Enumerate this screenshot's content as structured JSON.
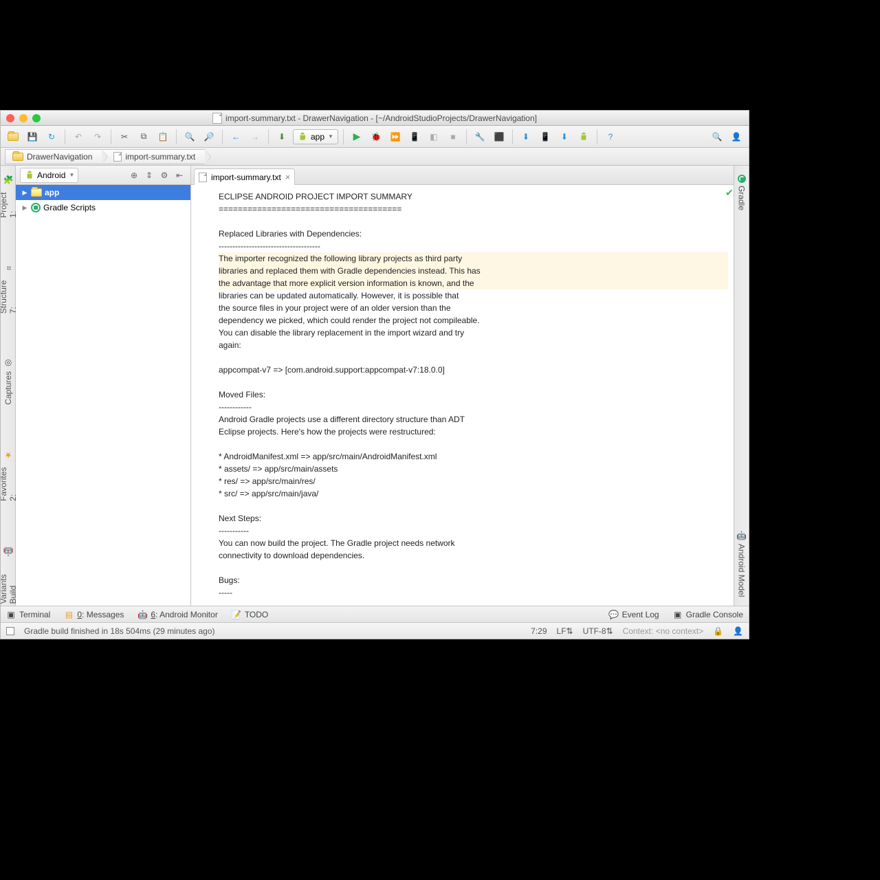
{
  "title": "import-summary.txt - DrawerNavigation - [~/AndroidStudioProjects/DrawerNavigation]",
  "breadcrumb": {
    "root": "DrawerNavigation",
    "file": "import-summary.txt"
  },
  "module_selector": "app",
  "sidebar": {
    "view": "Android",
    "items": [
      {
        "label": "app",
        "type": "folder",
        "selected": true,
        "expandable": true
      },
      {
        "label": "Gradle Scripts",
        "type": "gradle",
        "selected": false,
        "expandable": true
      }
    ]
  },
  "editor": {
    "tab": "import-summary.txt",
    "lines": [
      "ECLIPSE ANDROID PROJECT IMPORT SUMMARY",
      "======================================",
      "",
      "Replaced Libraries with Dependencies:",
      "-------------------------------------",
      "The importer recognized the following library projects as third party",
      "libraries and replaced them with Gradle dependencies instead. This has",
      "the advantage that more explicit version information is known, and the",
      "libraries can be updated automatically. However, it is possible that",
      "the source files in your project were of an older version than the",
      "dependency we picked, which could render the project not compileable.",
      "You can disable the library replacement in the import wizard and try",
      "again:",
      "",
      "appcompat-v7 => [com.android.support:appcompat-v7:18.0.0]",
      "",
      "Moved Files:",
      "------------",
      "Android Gradle projects use a different directory structure than ADT",
      "Eclipse projects. Here's how the projects were restructured:",
      "",
      "* AndroidManifest.xml => app/src/main/AndroidManifest.xml",
      "* assets/ => app/src/main/assets",
      "* res/ => app/src/main/res/",
      "* src/ => app/src/main/java/",
      "",
      "Next Steps:",
      "-----------",
      "You can now build the project. The Gradle project needs network",
      "connectivity to download dependencies.",
      "",
      "Bugs:",
      "-----"
    ],
    "highlight": [
      5,
      6,
      7
    ]
  },
  "left_tabs": [
    "1: Project",
    "7: Structure",
    "Captures",
    "2: Favorites",
    "Build Variants"
  ],
  "right_tabs": [
    "Gradle",
    "Android Model"
  ],
  "bottom_panels": {
    "terminal": "Terminal",
    "messages": "0: Messages",
    "monitor": "6: Android Monitor",
    "todo": "TODO",
    "eventlog": "Event Log",
    "gradle": "Gradle Console"
  },
  "status": {
    "message": "Gradle build finished in 18s 504ms (29 minutes ago)",
    "cursor": "7:29",
    "line_sep": "LF",
    "encoding": "UTF-8",
    "context_label": "Context:",
    "context_value": "<no context>"
  }
}
